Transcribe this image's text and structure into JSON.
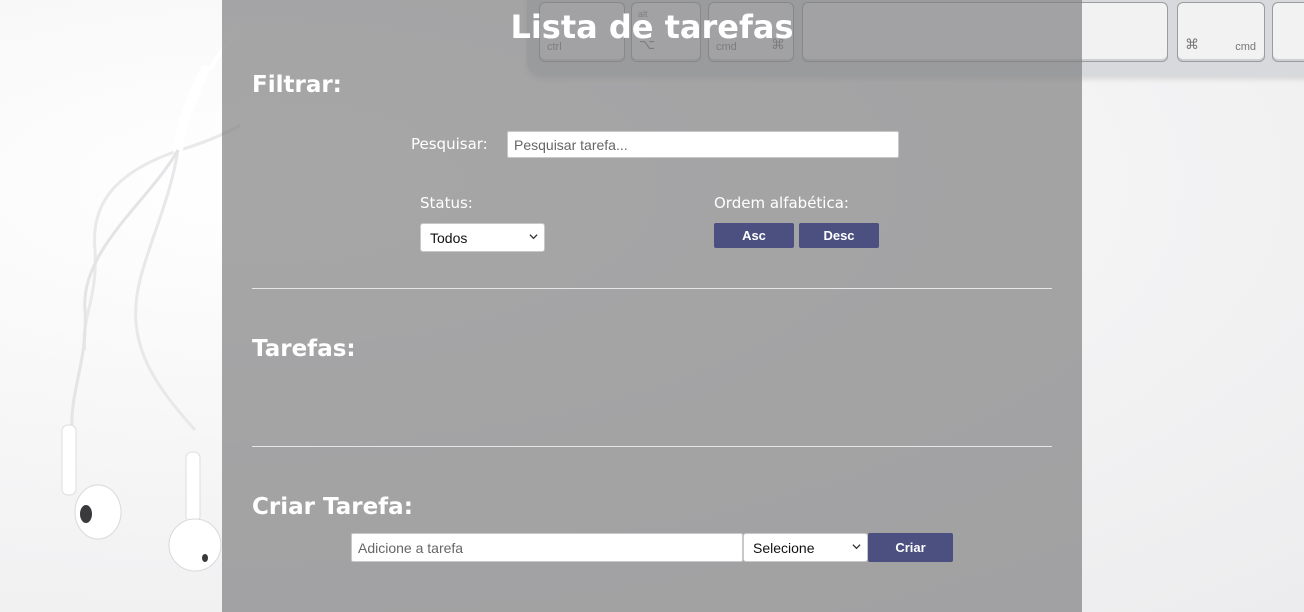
{
  "header": {
    "title": "Lista de tarefas"
  },
  "filter": {
    "section_title": "Filtrar:",
    "search_label": "Pesquisar:",
    "search_placeholder": "Pesquisar tarefa...",
    "status_label": "Status:",
    "status_selected": "Todos",
    "order_label": "Ordem alfabética:",
    "asc_label": "Asc",
    "desc_label": "Desc"
  },
  "tasks": {
    "section_title": "Tarefas:",
    "items": []
  },
  "create": {
    "section_title": "Criar Tarefa:",
    "input_placeholder": "Adicione a tarefa",
    "select_selected": "Selecione",
    "create_label": "Criar"
  },
  "background": {
    "keys": [
      {
        "top": "",
        "bottom": "ctrl",
        "symbol": ""
      },
      {
        "top": "alt",
        "bottom": "",
        "symbol": "⌥"
      },
      {
        "top": "",
        "bottom": "cmd",
        "symbol": "⌘"
      },
      {
        "top": "",
        "bottom": "",
        "symbol": ""
      },
      {
        "top": "",
        "bottom": "⌘",
        "symbol": "cmd"
      }
    ]
  },
  "colors": {
    "panel_overlay": "#808082",
    "button": "#4b5080",
    "text": "#ffffff",
    "divider": "#e6e6e8"
  }
}
